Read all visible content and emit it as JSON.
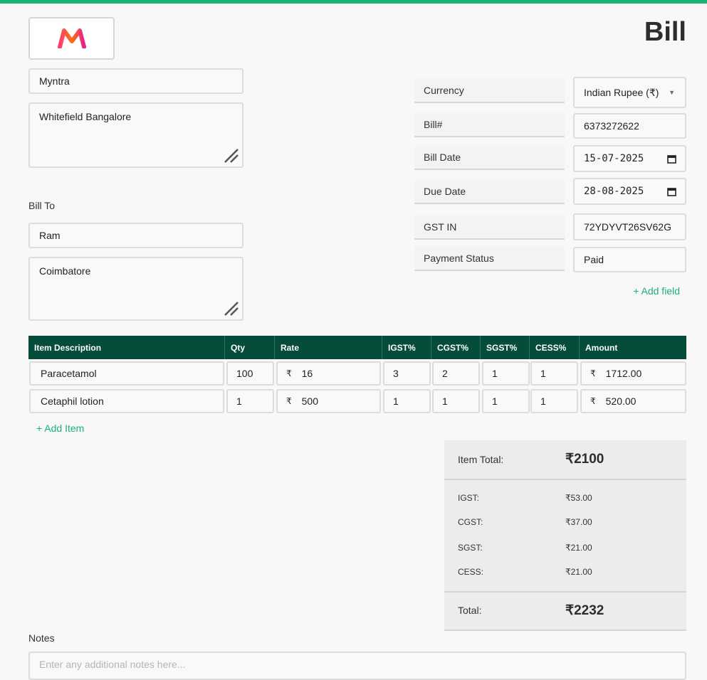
{
  "header": {
    "title": "Bill"
  },
  "brand": {
    "logo_icon": "myntra-logo-icon",
    "logo_colors": [
      "#ff3f6c",
      "#f59e0b",
      "#e91e8c"
    ]
  },
  "from": {
    "name": "Myntra",
    "address": "Whitefield Bangalore"
  },
  "bill_to": {
    "label": "Bill To",
    "name": "Ram",
    "address": "Coimbatore"
  },
  "fields": {
    "currency": {
      "label": "Currency",
      "value": "Indian Rupee (₹)"
    },
    "bill_number": {
      "label": "Bill#",
      "value": "6373272622"
    },
    "bill_date": {
      "label": "Bill Date",
      "value": "15-07-2025"
    },
    "due_date": {
      "label": "Due Date",
      "value": "28-08-2025"
    },
    "gst_in": {
      "label": "GST IN",
      "value": "72YDYVT26SV62G"
    },
    "payment_status": {
      "label": "Payment Status",
      "value": "Paid"
    },
    "add_field": "+ Add field"
  },
  "table": {
    "headers": [
      "Item Description",
      "Qty",
      "Rate",
      "IGST%",
      "CGST%",
      "SGST%",
      "CESS%",
      "Amount"
    ],
    "currency_symbol": "₹",
    "rows": [
      {
        "description": "Paracetamol",
        "qty": "100",
        "rate": "16",
        "igst": "3",
        "cgst": "2",
        "sgst": "1",
        "cess": "1",
        "amount": "1712.00"
      },
      {
        "description": "Cetaphil lotion",
        "qty": "1",
        "rate": "500",
        "igst": "1",
        "cgst": "1",
        "sgst": "1",
        "cess": "1",
        "amount": "520.00"
      }
    ],
    "add_item": "+ Add Item"
  },
  "summary": {
    "item_total_label": "Item Total:",
    "item_total": "₹2100",
    "igst_label": "IGST:",
    "igst": "₹53.00",
    "cgst_label": "CGST:",
    "cgst": "₹37.00",
    "sgst_label": "SGST:",
    "sgst": "₹21.00",
    "cess_label": "CESS:",
    "cess": "₹21.00",
    "total_label": "Total:",
    "total": "₹2232"
  },
  "notes": {
    "label": "Notes",
    "placeholder": "Enter any additional notes here..."
  },
  "colors": {
    "accent": "#1bb074",
    "table_header": "#054d3a"
  }
}
